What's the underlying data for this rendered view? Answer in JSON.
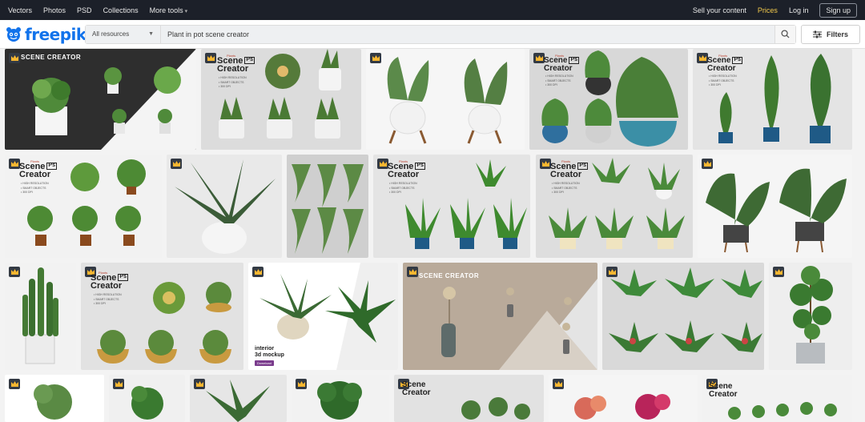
{
  "topbar": {
    "nav": [
      "Vectors",
      "Photos",
      "PSD",
      "Collections",
      "More tools"
    ],
    "sell": "Sell your content",
    "prices": "Prices",
    "login": "Log in",
    "signup": "Sign up"
  },
  "logo": {
    "text": "freepik"
  },
  "search": {
    "resources": "All resources",
    "query": "Plant in pot scene creator",
    "filters": "Filters"
  },
  "tiles": {
    "t1": {
      "title": "SCENE CREATOR"
    },
    "t2": {
      "top": "Plants",
      "title1": "Scene",
      "title2": "Creator",
      "ps": "Ps",
      "b1": "• HIGH RESOLUTION",
      "b2": "• SMART OBJECTS",
      "b3": "• 300 DPI"
    },
    "t4": {
      "top": "Plants",
      "title1": "Scene",
      "title2": "Creator",
      "ps": "Ps",
      "b1": "• HIGH RESOLUTION",
      "b2": "• SMART OBJECTS",
      "b3": "• 300 DPI"
    },
    "t5": {
      "top": "Plants",
      "title1": "Scene",
      "title2": "Creator",
      "ps": "Ps",
      "b1": "• HIGH RESOLUTION",
      "b2": "• SMART OBJECTS",
      "b3": "• 300 DPI"
    },
    "t6": {
      "top": "Plants",
      "title1": "Scene",
      "title2": "Creator",
      "ps": "Ps",
      "b1": "• HIGH RESOLUTION",
      "b2": "• SMART OBJECTS",
      "b3": "• 300 DPI"
    },
    "t9": {
      "top": "Plants",
      "title1": "Scene",
      "title2": "Creator",
      "ps": "Ps",
      "b1": "• HIGH RESOLUTION",
      "b2": "• SMART OBJECTS",
      "b3": "• 300 DPI"
    },
    "t10": {
      "top": "Plants",
      "title1": "Scene",
      "title2": "Creator",
      "ps": "Ps",
      "b1": "• HIGH RESOLUTION",
      "b2": "• SMART OBJECTS",
      "b3": "• 300 DPI"
    },
    "t13": {
      "top": "Plants",
      "title1": "Scene",
      "title2": "Creator",
      "ps": "Ps",
      "b1": "• HIGH RESOLUTION",
      "b2": "• SMART OBJECTS",
      "b3": "• 300 DPI"
    },
    "t14": {
      "line1": "interior",
      "line2": "3d mockup",
      "btn": "Download"
    },
    "t15": {
      "title": "SCENE CREATOR"
    },
    "t22": {
      "title": "Scene",
      "title2": "Creator"
    },
    "t25": {
      "title": "Scene",
      "title2": "Creator"
    }
  },
  "colors": {
    "accent": "#1273eb",
    "prices": "#f2c94c",
    "topbar": "#1c2029",
    "crown": "#f7b731"
  }
}
